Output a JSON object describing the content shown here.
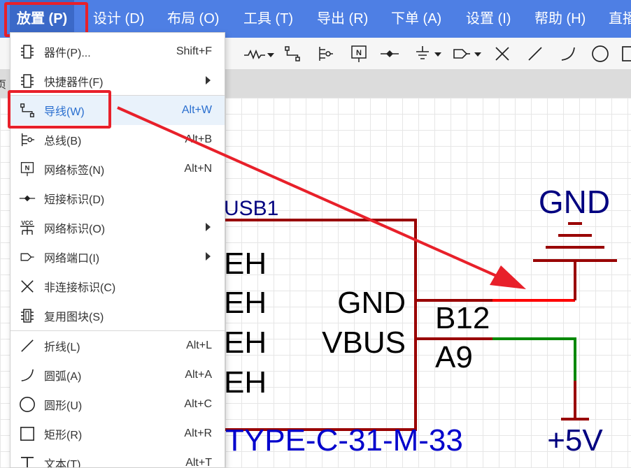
{
  "menubar": {
    "items": [
      {
        "label": "放置 (P)",
        "active": true
      },
      {
        "label": "设计 (D)"
      },
      {
        "label": "布局 (O)"
      },
      {
        "label": "工具 (T)"
      },
      {
        "label": "导出 (R)"
      },
      {
        "label": "下单 (A)"
      },
      {
        "label": "设置 (I)"
      },
      {
        "label": "帮助 (H)"
      },
      {
        "label": "直播"
      }
    ]
  },
  "toolbar": {
    "icons": [
      "resistor-dropdown-icon",
      "wire-icon",
      "bus-icon",
      "net-label-icon",
      "short-flag-icon",
      "ground-dropdown-icon",
      "net-port-dropdown-icon",
      "no-connect-icon",
      "line-icon",
      "arc-icon",
      "circle-icon",
      "rectangle-icon"
    ]
  },
  "tabstrip": {
    "glyph": "页"
  },
  "dropdown": {
    "items": [
      {
        "label": "器件(P)...",
        "shortcut": "Shift+F",
        "icon": "component-icon"
      },
      {
        "label": "快捷器件(F)",
        "submenu": true,
        "icon": "component-icon"
      },
      {
        "label": "导线(W)",
        "shortcut": "Alt+W",
        "icon": "wire-icon",
        "highlighted": true
      },
      {
        "label": "总线(B)",
        "shortcut": "Alt+B",
        "icon": "bus-icon"
      },
      {
        "label": "网络标签(N)",
        "shortcut": "Alt+N",
        "icon": "net-label-icon"
      },
      {
        "label": "短接标识(D)",
        "icon": "short-flag-icon"
      },
      {
        "label": "网络标识(O)",
        "submenu": true,
        "icon": "vcc-icon",
        "icon_text": "VCC"
      },
      {
        "label": "网络端口(I)",
        "submenu": true,
        "icon": "net-port-icon"
      },
      {
        "label": "非连接标识(C)",
        "icon": "no-connect-icon"
      },
      {
        "label": "复用图块(S)",
        "icon": "reuse-block-icon"
      },
      {
        "label": "折线(L)",
        "shortcut": "Alt+L",
        "icon": "line-icon"
      },
      {
        "label": "圆弧(A)",
        "shortcut": "Alt+A",
        "icon": "arc-icon"
      },
      {
        "label": "圆形(U)",
        "shortcut": "Alt+C",
        "icon": "circle-icon"
      },
      {
        "label": "矩形(R)",
        "shortcut": "Alt+R",
        "icon": "rectangle-icon"
      },
      {
        "label": "文本(T)",
        "shortcut": "Alt+T",
        "icon": "text-icon"
      }
    ]
  },
  "schematic": {
    "designator": "USB1",
    "left_pins": [
      "EH",
      "EH",
      "EH",
      "EH"
    ],
    "pin_names": [
      "GND",
      "VBUS"
    ],
    "pin_numbers": [
      "B12",
      "A9"
    ],
    "part_name": "TYPE-C-31-M-33",
    "gnd_label": "GND",
    "power_label": "+5V"
  },
  "colors": {
    "menubar": "#4e7fe4",
    "highlight_red": "#e8202a",
    "component": "#990000",
    "wire_selected": "#ff0000",
    "wire_normal": "#008800",
    "net_text": "#000080"
  }
}
